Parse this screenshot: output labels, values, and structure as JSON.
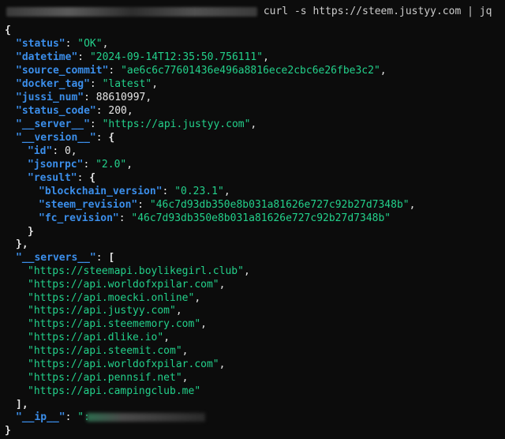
{
  "command": "curl -s https://steem.justyy.com | jq",
  "json": {
    "status": "\"OK\"",
    "datetime": "\"2024-09-14T12:35:50.756111\"",
    "source_commit": "\"ae6c6c77601436e496a8816ece2cbc6e26fbe3c2\"",
    "docker_tag": "\"latest\"",
    "jussi_num": "88610997",
    "status_code": "200",
    "server": "\"https://api.justyy.com\"",
    "version": {
      "id": "0",
      "jsonrpc": "\"2.0\"",
      "blockchain_version": "\"0.23.1\"",
      "steem_revision": "\"46c7d93db350e8b031a81626e727c92b27d7348b\"",
      "fc_revision": "\"46c7d93db350e8b031a81626e727c92b27d7348b\""
    },
    "servers": [
      "\"https://steemapi.boylikegirl.club\"",
      "\"https://api.worldofxpilar.com\"",
      "\"https://api.moecki.online\"",
      "\"https://api.justyy.com\"",
      "\"https://api.steememory.com\"",
      "\"https://api.dlike.io\"",
      "\"https://api.steemit.com\"",
      "\"https://api.worldofxpilar.com\"",
      "\"https://api.pennsif.net\"",
      "\"https://api.campingclub.me\""
    ],
    "ip_prefix": "\":"
  },
  "keys": {
    "status": "\"status\"",
    "datetime": "\"datetime\"",
    "source_commit": "\"source_commit\"",
    "docker_tag": "\"docker_tag\"",
    "jussi_num": "\"jussi_num\"",
    "status_code": "\"status_code\"",
    "server": "\"__server__\"",
    "version": "\"__version__\"",
    "id": "\"id\"",
    "jsonrpc": "\"jsonrpc\"",
    "result": "\"result\"",
    "blockchain_version": "\"blockchain_version\"",
    "steem_revision": "\"steem_revision\"",
    "fc_revision": "\"fc_revision\"",
    "servers": "\"__servers__\"",
    "ip": "\"__ip__\""
  },
  "colors": {
    "background": "#0c0c0c",
    "key": "#3b8eea",
    "string": "#23d18b",
    "plain": "#cccccc"
  }
}
